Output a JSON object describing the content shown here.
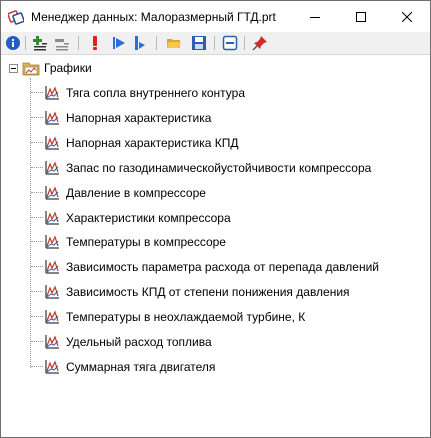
{
  "window": {
    "title": "Менеджер данных: Малоразмерный ГТД.prt",
    "app_icon": "data-manager-icon",
    "controls": [
      "minimize-icon",
      "maximize-icon",
      "close-icon"
    ]
  },
  "toolbar": {
    "buttons": [
      {
        "icon": "info-icon",
        "color": "#1f5fbf"
      },
      {
        "icon": "expand-tree-icon",
        "color": "#2e8b2e"
      },
      {
        "icon": "collapse-tree-icon",
        "color": "#7a7a7a"
      },
      {
        "icon": "exclamation-icon",
        "color": "#e02020"
      },
      {
        "icon": "run-forward-icon",
        "color": "#2a6fd6"
      },
      {
        "icon": "step-icon",
        "color": "#2a6fd6"
      },
      {
        "icon": "open-folder-icon",
        "color": "#e0a62a"
      },
      {
        "icon": "save-icon",
        "color": "#2a5fb0"
      },
      {
        "icon": "minus-box-icon",
        "color": "#2a5fb0"
      },
      {
        "icon": "pin-icon",
        "color": "#d42a2a"
      }
    ]
  },
  "tree": {
    "root": {
      "label": "Графики",
      "expanded": true,
      "icon": "folder-icon"
    },
    "items": [
      {
        "label": "Тяга сопла внутреннего контура",
        "icon": "graph-icon"
      },
      {
        "label": "Напорная характеристика",
        "icon": "graph-icon"
      },
      {
        "label": "Напорная характеристика КПД",
        "icon": "graph-icon"
      },
      {
        "label": "Запас по газодинамическойустойчивости компрессора",
        "icon": "graph-icon"
      },
      {
        "label": "Давление в компрессоре",
        "icon": "graph-icon"
      },
      {
        "label": "Характеристики компрессора",
        "icon": "graph-icon"
      },
      {
        "label": "Температуры в компрессоре",
        "icon": "graph-icon"
      },
      {
        "label": "Зависимость параметра расхода от перепада давлений",
        "icon": "graph-icon"
      },
      {
        "label": "Зависимость КПД от степени понижения давления",
        "icon": "graph-icon"
      },
      {
        "label": "Температуры в неохлаждаемой турбине, К",
        "icon": "graph-icon"
      },
      {
        "label": "Удельный расход топлива",
        "icon": "graph-icon"
      },
      {
        "label": "Суммарная тяга двигателя",
        "icon": "graph-icon"
      }
    ]
  }
}
